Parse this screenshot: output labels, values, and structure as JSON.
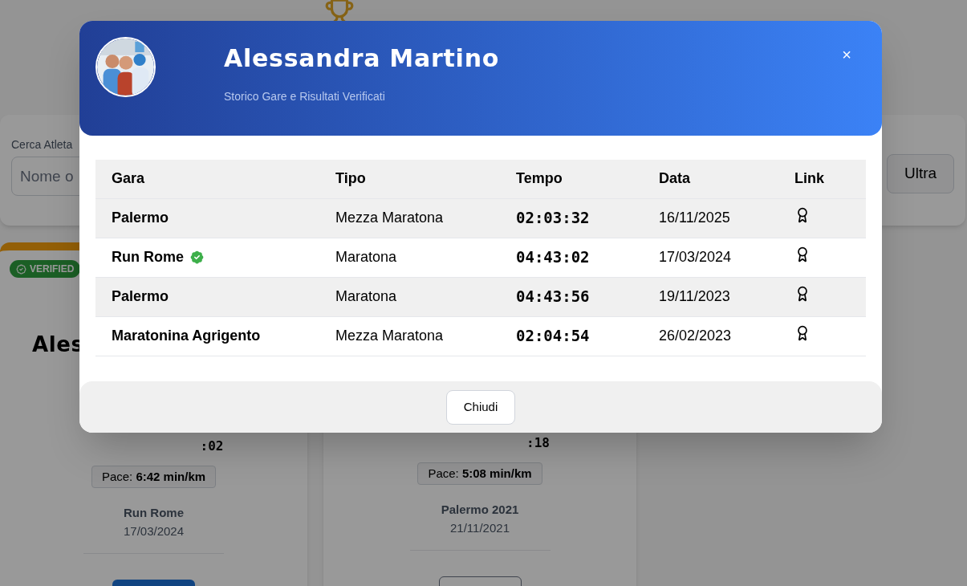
{
  "search": {
    "label": "Cerca Atleta",
    "placeholder": "Nome o",
    "filters": [
      {
        "label": "Ultra",
        "selected": false
      }
    ]
  },
  "cards": [
    {
      "badge": "VERIFIED",
      "name": "Ales",
      "time_seconds": ":02",
      "pace": "Pace: **6:42 min/km**",
      "race": "Run Rome",
      "date": "17/03/2024",
      "primary": true
    },
    {
      "time_seconds": ":18",
      "pace": "Pace: **5:08 min/km**",
      "race": "Palermo 2021",
      "date": "21/11/2021",
      "primary": false
    }
  ],
  "modal": {
    "athlete": "Alessandra Martino",
    "subtitle": "Storico Gare e Risultati Verificati",
    "close": "×",
    "table": {
      "columns": [
        "Gara",
        "Tipo",
        "Tempo",
        "Data",
        "Link"
      ],
      "rows": [
        {
          "race": "Palermo",
          "type": "Mezza Maratona",
          "time": "02:03:32",
          "date": "16/11/2025",
          "verified": false
        },
        {
          "race": "Run Rome",
          "type": "Maratona",
          "time": "04:43:02",
          "date": "17/03/2024",
          "verified": true
        },
        {
          "race": "Palermo",
          "type": "Maratona",
          "time": "04:43:56",
          "date": "19/11/2023",
          "verified": false
        },
        {
          "race": "Maratonina Agrigento",
          "type": "Mezza Maratona",
          "time": "02:04:54",
          "date": "26/02/2023",
          "verified": false
        }
      ]
    },
    "footer_button": "Chiudi"
  }
}
